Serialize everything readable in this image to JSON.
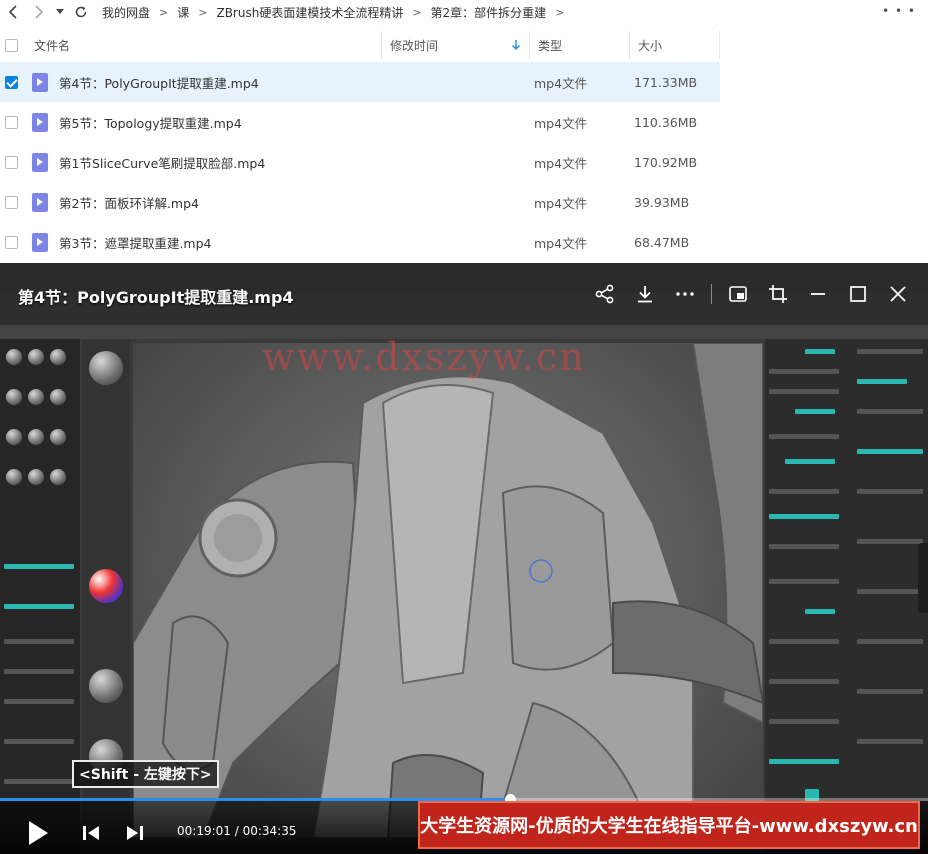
{
  "nav": {
    "back_icon": "chevron-left-icon",
    "forward_icon": "chevron-right-icon",
    "history_icon": "caret-down-icon",
    "refresh_icon": "refresh-icon",
    "more_label": "• • •"
  },
  "breadcrumb": [
    "我的网盘",
    "课",
    "ZBrush硬表面建模技术全流程精讲",
    "第2章：部件拆分重建"
  ],
  "breadcrumb_sep": ">",
  "columns": {
    "name": "文件名",
    "modified": "修改时间",
    "type": "类型",
    "size": "大小"
  },
  "files": [
    {
      "name": "第4节：PolyGroupIt提取重建.mp4",
      "type": "mp4文件",
      "size": "171.33MB",
      "selected": true
    },
    {
      "name": "第5节：Topology提取重建.mp4",
      "type": "mp4文件",
      "size": "110.36MB",
      "selected": false
    },
    {
      "name": "第1节SliceCurve笔刷提取脸部.mp4",
      "type": "mp4文件",
      "size": "170.92MB",
      "selected": false
    },
    {
      "name": "第2节：面板环详解.mp4",
      "type": "mp4文件",
      "size": "39.93MB",
      "selected": false
    },
    {
      "name": "第3节：遮罩提取重建.mp4",
      "type": "mp4文件",
      "size": "68.47MB",
      "selected": false
    }
  ],
  "player": {
    "title": "第4节：PolyGroupIt提取重建.mp4",
    "watermark": "www.dxszyw.cn",
    "shift_hint": "<Shift - 左键按下>",
    "current_time": "00:19:01",
    "duration": "00:34:35",
    "progress_fraction": 0.55,
    "banner": "大学生资源网-优质的大学生在线指导平台-www.dxszyw.cn",
    "accent_color": "#2c8ef2",
    "banner_color": "#c0241a"
  },
  "colors": {
    "selected_row": "#e6f2fc",
    "checkbox_checked": "#0a84e0",
    "video_icon": "#7d84e6",
    "sort_arrow": "#2f8de4"
  }
}
